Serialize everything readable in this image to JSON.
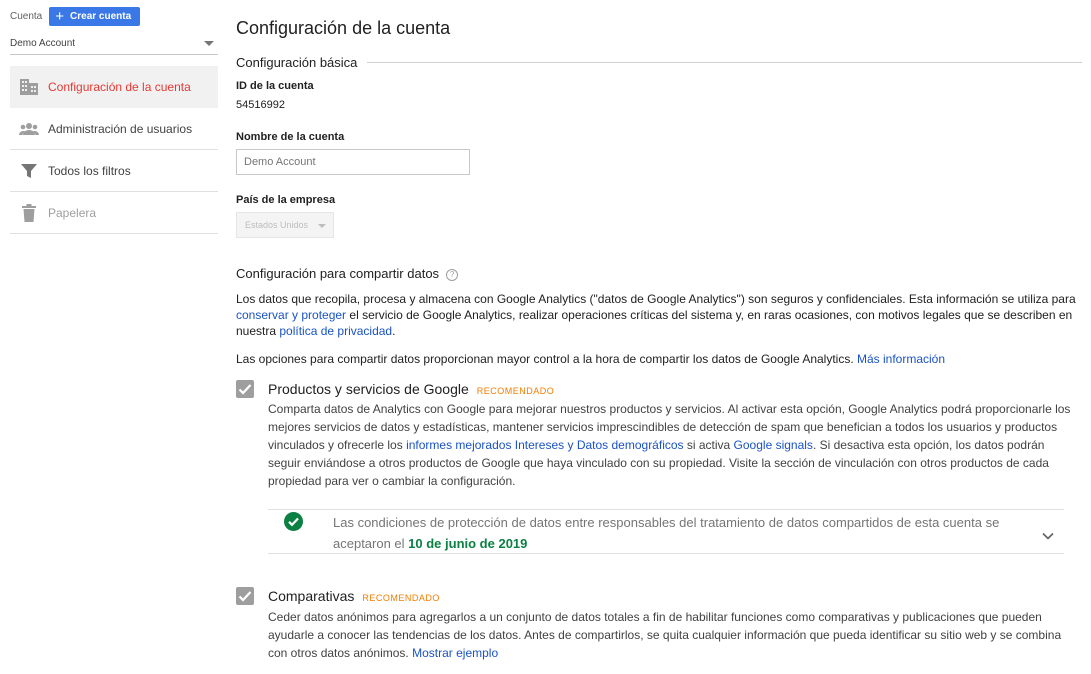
{
  "sidebar": {
    "account_label": "Cuenta",
    "create_button": "Crear cuenta",
    "account_select_value": "Demo Account",
    "items": [
      {
        "label": "Configuración de la cuenta",
        "icon": "building-icon",
        "active": true
      },
      {
        "label": "Administración de usuarios",
        "icon": "users-icon"
      },
      {
        "label": "Todos los filtros",
        "icon": "filter-icon"
      },
      {
        "label": "Papelera",
        "icon": "trash-icon",
        "disabled": true
      }
    ]
  },
  "main": {
    "title": "Configuración de la cuenta",
    "basic_section": "Configuración básica",
    "account_id_label": "ID de la cuenta",
    "account_id": "54516992",
    "account_name_label": "Nombre de la cuenta",
    "account_name_placeholder": "Demo Account",
    "country_label": "País de la empresa",
    "country_value": "Estados Unidos",
    "share_section": "Configuración para compartir datos",
    "help_icon": "?",
    "intro": {
      "p1_a": "Los datos que recopila, procesa y almacena con Google Analytics (\"datos de Google Analytics\") son seguros y confidenciales. Esta información se utiliza para ",
      "p1_link1": "conservar y proteger",
      "p1_b": " el servicio de Google Analytics, realizar operaciones críticas del sistema y, en raras ocasiones, con motivos legales que se describen en nuestra ",
      "p1_link2": "política de privacidad",
      "p1_c": ".",
      "p2": "Las opciones para compartir datos proporcionan mayor control a la hora de compartir los datos de Google Analytics. ",
      "p2_link": "Más información"
    },
    "options": [
      {
        "title": "Productos y servicios de Google",
        "badge": "RECOMENDADO",
        "checked": true,
        "desc_a": "Comparta datos de Analytics con Google para mejorar nuestros productos y servicios. Al activar esta opción, Google Analytics podrá proporcionarle los mejores servicios de datos y estadísticas, mantener servicios imprescindibles de detección de spam que benefician a todos los usuarios y productos vinculados y ofrecerle los ",
        "desc_link1": "informes mejorados Intereses y Datos demográficos",
        "desc_b": " si activa ",
        "desc_link2": "Google signals",
        "desc_c": ". Si desactiva esta opción, los datos podrán seguir enviándose a otros productos de Google que haya vinculado con su propiedad. Visite la sección de vinculación con otros productos de cada propiedad para ver o cambiar la configuración."
      },
      {
        "title": "Comparativas",
        "badge": "RECOMENDADO",
        "checked": true,
        "desc_a": "Ceder datos anónimos para agregarlos a un conjunto de datos totales a fin de habilitar funciones como comparativas y publicaciones que pueden ayudarle a conocer las tendencias de los datos. Antes de compartirlos, se quita cualquier información que pueda identificar su sitio web y se combina con otros datos anónimos. ",
        "desc_link": "Mostrar ejemplo"
      }
    ],
    "terms": {
      "text": "Las condiciones de protección de datos entre responsables del tratamiento de datos compartidos de esta cuenta se aceptaron el ",
      "date": "10 de junio de 2019"
    }
  },
  "colors": {
    "primary_button": "#3b78e7",
    "active_nav": "#e53935",
    "link": "#1a53c4",
    "badge": "#f57c00",
    "success": "#0b8043"
  }
}
